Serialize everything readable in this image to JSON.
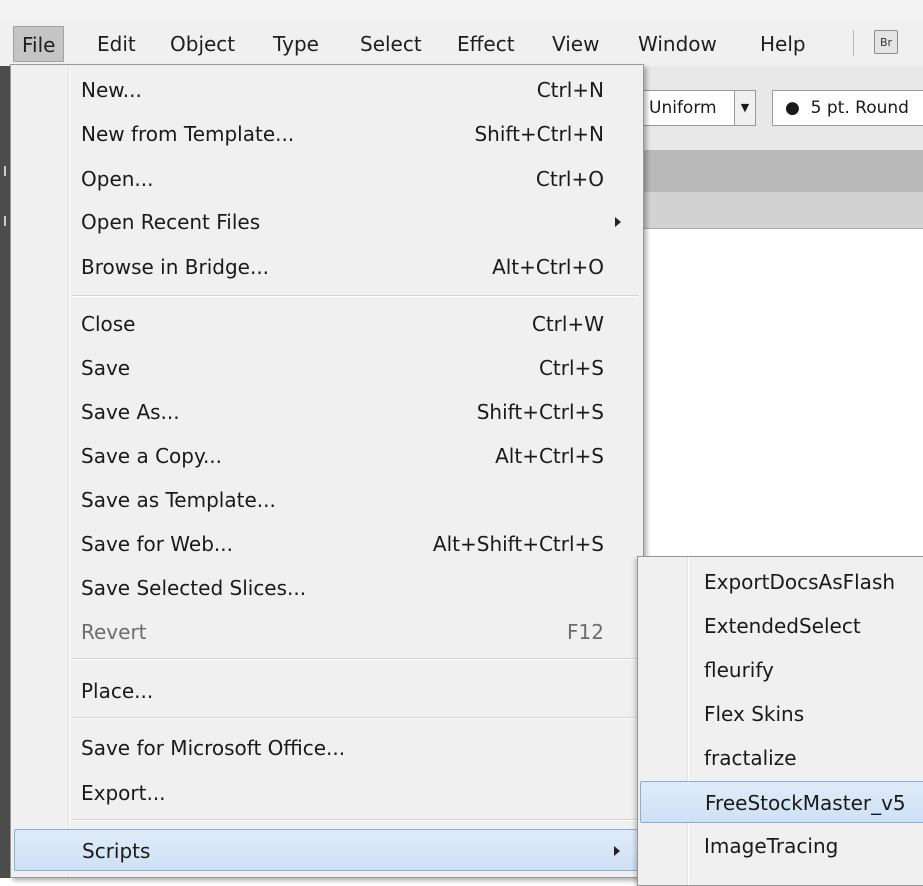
{
  "menubar": {
    "items": [
      "File",
      "Edit",
      "Object",
      "Type",
      "Select",
      "Effect",
      "View",
      "Window",
      "Help"
    ],
    "active_index": 0,
    "bridge_badge": "Br"
  },
  "controlbar": {
    "uniform_value": "Uniform",
    "stroke_value": "5 pt. Round"
  },
  "file_menu": {
    "items": [
      {
        "label": "New...",
        "shortcut": "Ctrl+N"
      },
      {
        "label": "New from Template...",
        "shortcut": "Shift+Ctrl+N"
      },
      {
        "label": "Open...",
        "shortcut": "Ctrl+O"
      },
      {
        "label": "Open Recent Files",
        "shortcut": "",
        "submenu": true
      },
      {
        "label": "Browse in Bridge...",
        "shortcut": "Alt+Ctrl+O"
      },
      {
        "label": "Close",
        "shortcut": "Ctrl+W"
      },
      {
        "label": "Save",
        "shortcut": "Ctrl+S"
      },
      {
        "label": "Save As...",
        "shortcut": "Shift+Ctrl+S"
      },
      {
        "label": "Save a Copy...",
        "shortcut": "Alt+Ctrl+S"
      },
      {
        "label": "Save as Template...",
        "shortcut": ""
      },
      {
        "label": "Save for Web...",
        "shortcut": "Alt+Shift+Ctrl+S"
      },
      {
        "label": "Save Selected Slices...",
        "shortcut": ""
      },
      {
        "label": "Revert",
        "shortcut": "F12",
        "disabled": true
      },
      {
        "label": "Place...",
        "shortcut": ""
      },
      {
        "label": "Save for Microsoft Office...",
        "shortcut": ""
      },
      {
        "label": "Export...",
        "shortcut": ""
      },
      {
        "label": "Scripts",
        "shortcut": "",
        "submenu": true,
        "highlighted": true
      }
    ]
  },
  "scripts_submenu": {
    "items": [
      {
        "label": "ExportDocsAsFlash"
      },
      {
        "label": "ExtendedSelect"
      },
      {
        "label": "fleurify"
      },
      {
        "label": "Flex Skins"
      },
      {
        "label": "fractalize"
      },
      {
        "label": "FreeStockMaster_v5",
        "highlighted": true
      },
      {
        "label": "ImageTracing"
      }
    ]
  },
  "colors": {
    "menu_bg": "#f0f0f0",
    "highlight_bg": "#cfe1f5",
    "highlight_border": "#88acd6",
    "disabled_text": "#6d6d6d"
  }
}
